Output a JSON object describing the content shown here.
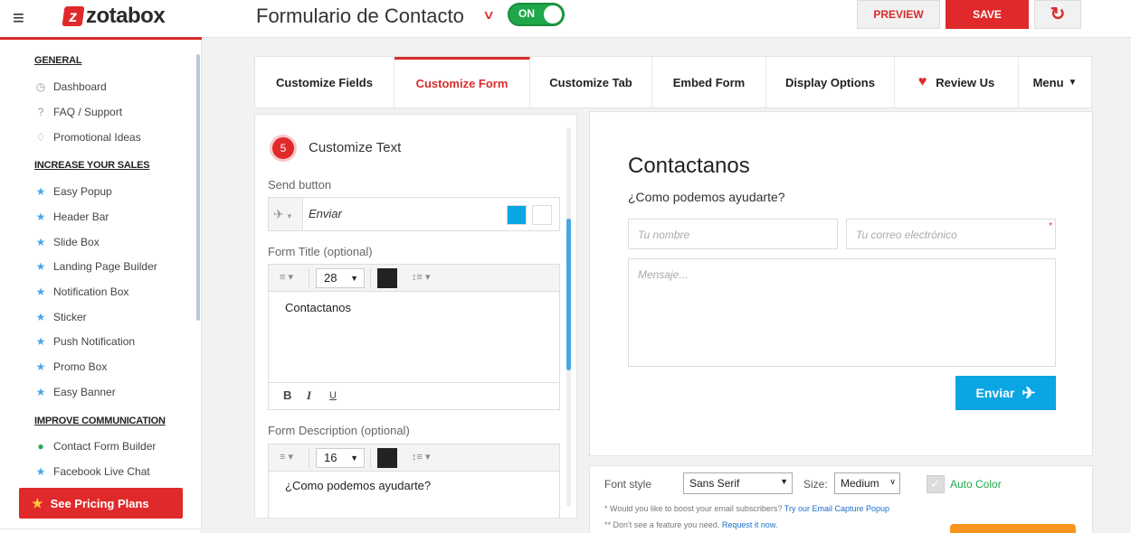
{
  "brand": {
    "logo_letter": "z",
    "logo_text": "zotabox",
    "accent": "#e0292b"
  },
  "header": {
    "menu_icon": "≡",
    "form_title": "Formulario de Contacto",
    "toggle_label": "ON",
    "toggle_on": true,
    "preview_label": "PREVIEW",
    "save_label": "SAVE",
    "refresh_icon": "↻"
  },
  "sidebar": {
    "general": {
      "heading": "GENERAL",
      "items": [
        {
          "label": "Dashboard",
          "icon": "gauge-icon",
          "glyph": "◷"
        },
        {
          "label": "FAQ / Support",
          "icon": "question-icon",
          "glyph": "?"
        },
        {
          "label": "Promotional Ideas",
          "icon": "bulb-icon",
          "glyph": "♢"
        }
      ]
    },
    "sales": {
      "heading": "INCREASE YOUR SALES",
      "items": [
        {
          "label": "Easy Popup"
        },
        {
          "label": "Header Bar"
        },
        {
          "label": "Slide Box"
        },
        {
          "label": "Landing Page Builder"
        },
        {
          "label": "Notification Box"
        },
        {
          "label": "Sticker"
        },
        {
          "label": "Push Notification"
        },
        {
          "label": "Promo Box"
        },
        {
          "label": "Easy Banner"
        }
      ]
    },
    "communication": {
      "heading": "IMPROVE COMMUNICATION",
      "items": [
        {
          "label": "Contact Form Builder",
          "active": true
        },
        {
          "label": "Facebook Live Chat"
        }
      ]
    },
    "pricing_label": "See Pricing Plans"
  },
  "tabs": [
    {
      "label": "Customize Fields",
      "active": false
    },
    {
      "label": "Customize Form",
      "active": true
    },
    {
      "label": "Customize Tab",
      "active": false
    },
    {
      "label": "Embed Form",
      "active": false
    },
    {
      "label": "Display Options",
      "active": false
    },
    {
      "label": "Review Us",
      "active": false,
      "icon": "heart-icon"
    },
    {
      "label": "Menu",
      "active": false,
      "icon": "caret-down-icon"
    }
  ],
  "editor": {
    "step_number": "5",
    "step_title": "Customize Text",
    "send_button": {
      "label": "Send button",
      "value": "Enviar",
      "color_1": "#0aa5e3",
      "color_2": "#ffffff"
    },
    "form_title": {
      "label": "Form Title (optional)",
      "font_size": "28",
      "color": "#222222",
      "content": "Contactanos",
      "format_buttons": [
        "B",
        "I",
        "U"
      ]
    },
    "form_description": {
      "label": "Form Description (optional)",
      "font_size": "16",
      "color": "#222222",
      "content": "¿Como podemos ayudarte?"
    }
  },
  "preview": {
    "title": "Contactanos",
    "description": "¿Como podemos ayudarte?",
    "name_placeholder": "Tu nombre",
    "email_placeholder": "Tu correo electrónico",
    "email_required": "*",
    "message_placeholder": "Mensaje...",
    "send_label": "Enviar",
    "send_color": "#0aa5e3"
  },
  "options": {
    "font_style_label": "Font style",
    "font_style_value": "Sans Serif",
    "size_label": "Size:",
    "size_value": "Medium",
    "auto_color_label": "Auto Color",
    "note_1_prefix": "* Would you like to boost your email subscribers?",
    "note_1_link": "Try our Email Capture Popup",
    "note_2_prefix": "** Don't see a feature you need.",
    "note_2_link": "Request it now."
  }
}
